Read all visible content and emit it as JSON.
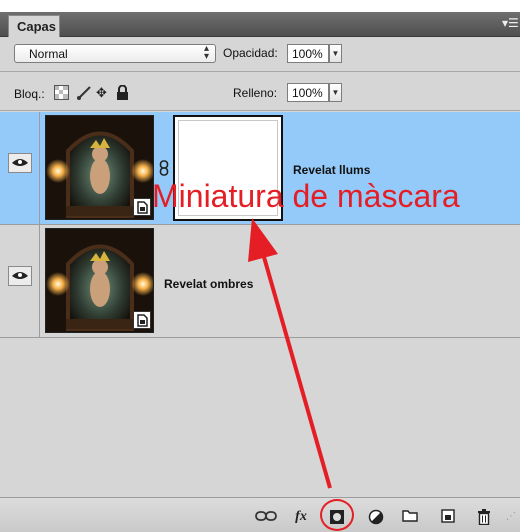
{
  "panel": {
    "tab_label": "Capas"
  },
  "blend": {
    "mode": "Normal",
    "opacity_label": "Opacidad:",
    "opacity_value": "100%"
  },
  "lock": {
    "label": "Bloq.:",
    "fill_label": "Relleno:",
    "fill_value": "100%"
  },
  "layers": [
    {
      "name": "Revelat llums",
      "visible": true,
      "selected": true,
      "has_mask": true
    },
    {
      "name": "Revelat ombres",
      "visible": true,
      "selected": false,
      "has_mask": false
    }
  ],
  "annotation": {
    "text": "Miniatura de màscara",
    "color": "#e41e24"
  },
  "bottom_bar": {
    "icons": [
      "link-icon",
      "fx-icon",
      "add-mask-icon",
      "adjustment-icon",
      "group-folder-icon",
      "new-layer-icon",
      "trash-icon"
    ],
    "fx_label": "fx"
  },
  "colors": {
    "selection": "#93caf9",
    "panel": "#d6d6d6",
    "annotation": "#e41e24"
  }
}
